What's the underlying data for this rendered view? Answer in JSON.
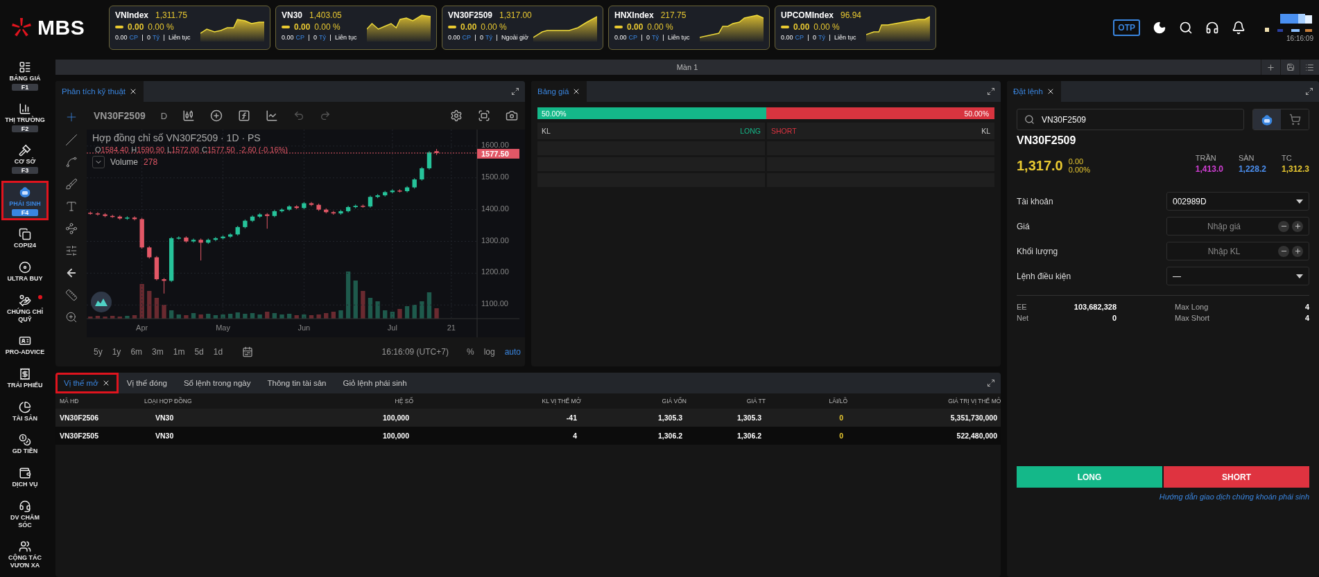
{
  "header": {
    "logo": "MBS",
    "tickers": [
      {
        "name": "VNIndex",
        "value": "1,311.75",
        "change": "0.00",
        "percent": "0.00 %",
        "volume": "0.00",
        "volume_unit": "CP",
        "traded": "0",
        "traded_unit": "Tỷ",
        "session": "Liên tục"
      },
      {
        "name": "VN30",
        "value": "1,403.05",
        "change": "0.00",
        "percent": "0.00 %",
        "volume": "0.00",
        "volume_unit": "CP",
        "traded": "0",
        "traded_unit": "Tỷ",
        "session": "Liên tục"
      },
      {
        "name": "VN30F2509",
        "value": "1,317.00",
        "change": "0.00",
        "percent": "0.00 %",
        "volume": "0.00",
        "volume_unit": "CP",
        "traded": "0",
        "traded_unit": "Tỷ",
        "session": "Ngoài giờ"
      },
      {
        "name": "HNXIndex",
        "value": "217.75",
        "change": "0.00",
        "percent": "0.00 %",
        "volume": "0.00",
        "volume_unit": "CP",
        "traded": "0",
        "traded_unit": "Tỷ",
        "session": "Liên tục"
      },
      {
        "name": "UPCOMIndex",
        "value": "96.94",
        "change": "0.00",
        "percent": "0.00 %",
        "volume": "0.00",
        "volume_unit": "CP",
        "traded": "0",
        "traded_unit": "Tỷ",
        "session": "Liên tục"
      }
    ],
    "otp": "OTP",
    "time": "16:16:09"
  },
  "sidebar": {
    "items": [
      {
        "label": "BẢNG GIÁ",
        "key": "F1",
        "selected": false
      },
      {
        "label": "THỊ TRƯỜNG",
        "key": "F2",
        "selected": false
      },
      {
        "label": "CƠ SỞ",
        "key": "F3",
        "selected": false
      },
      {
        "label": "PHÁI SINH",
        "key": "F4",
        "selected": true
      },
      {
        "label": "COPI24",
        "selected": false
      },
      {
        "label": "ULTRA BUY",
        "selected": false
      },
      {
        "label": "CHỨNG CHỈ QUỸ",
        "selected": false,
        "dot": true
      },
      {
        "label": "PRO-ADVICE",
        "selected": false
      },
      {
        "label": "TRÁI PHIẾU",
        "selected": false
      },
      {
        "label": "TÀI SẢN",
        "selected": false
      },
      {
        "label": "GD TIỀN",
        "selected": false
      },
      {
        "label": "DỊCH VỤ",
        "selected": false
      },
      {
        "label": "DV CHĂM SÓC",
        "selected": false
      },
      {
        "label": "CỘNG TÁC VƯƠN XA",
        "selected": false
      }
    ]
  },
  "workspace": {
    "title": "Màn 1"
  },
  "chart_panel": {
    "tab": "Phân tích kỹ thuật",
    "symbol": "VN30F2509",
    "interval": "D",
    "legend": "Hợp đồng chỉ số VN30F2509 · 1D · PS",
    "ohlc": [
      {
        "label": "O",
        "value": "1584.40"
      },
      {
        "label": "H",
        "value": "1590.90"
      },
      {
        "label": "L",
        "value": "1572.00"
      },
      {
        "label": "C",
        "value": "1577.50"
      }
    ],
    "change": "-2.60 (-0.16%)",
    "volume_label": "Volume",
    "volume_value": "278",
    "last_price": "1577.50",
    "ranges": [
      "5y",
      "1y",
      "6m",
      "3m",
      "1m",
      "5d",
      "1d"
    ],
    "time": "16:16:09 (UTC+7)",
    "scale_options": [
      {
        "label": "%",
        "selected": false
      },
      {
        "label": "log",
        "selected": false
      },
      {
        "label": "auto",
        "selected": true
      }
    ],
    "chart_data": {
      "type": "candlestick",
      "categories": [
        null,
        null,
        null,
        null,
        null,
        null,
        null,
        "Apr",
        null,
        null,
        null,
        null,
        null,
        null,
        null,
        null,
        null,
        null,
        "May",
        null,
        null,
        null,
        null,
        null,
        null,
        null,
        null,
        null,
        null,
        "Jun",
        null,
        null,
        null,
        null,
        null,
        null,
        null,
        null,
        null,
        null,
        null,
        "Jul",
        null,
        null,
        null,
        null,
        null,
        null,
        null,
        "21",
        null,
        null,
        null
      ],
      "ohlc": [
        [
          1390,
          1394,
          1384,
          1388
        ],
        [
          1388,
          1392,
          1381,
          1385
        ],
        [
          1385,
          1389,
          1376,
          1380
        ],
        [
          1380,
          1384,
          1374,
          1378
        ],
        [
          1378,
          1382,
          1368,
          1372
        ],
        [
          1372,
          1379,
          1368,
          1375
        ],
        [
          1375,
          1379,
          1366,
          1370
        ],
        [
          1370,
          1374,
          1277,
          1281
        ],
        [
          1281,
          1285,
          1246,
          1250
        ],
        [
          1250,
          1254,
          1177,
          1181
        ],
        [
          1181,
          1185,
          1136,
          1176
        ],
        [
          1176,
          1314,
          1172,
          1310
        ],
        [
          1310,
          1316,
          1306,
          1312
        ],
        [
          1312,
          1316,
          1296,
          1300
        ],
        [
          1300,
          1309,
          1296,
          1305
        ],
        [
          1305,
          1309,
          1240,
          1296
        ],
        [
          1296,
          1309,
          1292,
          1305
        ],
        [
          1305,
          1314,
          1301,
          1310
        ],
        [
          1310,
          1319,
          1306,
          1315
        ],
        [
          1315,
          1326,
          1311,
          1322
        ],
        [
          1322,
          1349,
          1318,
          1345
        ],
        [
          1345,
          1369,
          1341,
          1365
        ],
        [
          1365,
          1382,
          1361,
          1378
        ],
        [
          1378,
          1389,
          1374,
          1385
        ],
        [
          1385,
          1389,
          1340,
          1380
        ],
        [
          1380,
          1399,
          1376,
          1395
        ],
        [
          1395,
          1404,
          1391,
          1400
        ],
        [
          1400,
          1414,
          1396,
          1410
        ],
        [
          1410,
          1414,
          1401,
          1405
        ],
        [
          1405,
          1424,
          1401,
          1420
        ],
        [
          1420,
          1424,
          1411,
          1415
        ],
        [
          1415,
          1419,
          1396,
          1400
        ],
        [
          1400,
          1404,
          1388,
          1392
        ],
        [
          1392,
          1396,
          1384,
          1388
        ],
        [
          1388,
          1399,
          1384,
          1395
        ],
        [
          1395,
          1412,
          1391,
          1408
        ],
        [
          1408,
          1416,
          1404,
          1412
        ],
        [
          1412,
          1416,
          1406,
          1410
        ],
        [
          1410,
          1444,
          1406,
          1440
        ],
        [
          1440,
          1449,
          1436,
          1445
        ],
        [
          1445,
          1459,
          1441,
          1455
        ],
        [
          1455,
          1464,
          1451,
          1460
        ],
        [
          1460,
          1464,
          1454,
          1458
        ],
        [
          1458,
          1474,
          1454,
          1470
        ],
        [
          1470,
          1499,
          1466,
          1495
        ],
        [
          1495,
          1534,
          1491,
          1530
        ],
        [
          1530,
          1584,
          1526,
          1580
        ],
        [
          1584,
          1591,
          1572,
          1578
        ],
        null,
        null,
        null,
        null,
        null
      ],
      "ylim": [
        1057,
        1652
      ],
      "grid": true,
      "yticks": [
        {
          "value": 1100,
          "label": "1100.00"
        },
        {
          "value": 1200,
          "label": "1200.00"
        },
        {
          "value": 1300,
          "label": "1300.00"
        },
        {
          "value": 1400,
          "label": "1400.00"
        },
        {
          "value": 1500,
          "label": "1500.00"
        },
        {
          "value": 1600,
          "label": "1600.00"
        }
      ]
    }
  },
  "price_board": {
    "tab": "Bảng giá",
    "long": {
      "share": "50.00%",
      "level": 0.5
    },
    "short": {
      "share": "50.00%"
    },
    "columns": [
      "KL",
      "LONG",
      "SHORT",
      "KL"
    ]
  },
  "order_panel": {
    "tab": "Đặt lệnh",
    "search_value": "VN30F2509",
    "symbol": "VN30F2509",
    "price": "1,317.0",
    "change": "0.00",
    "percent": "0.00%",
    "ref_prices": [
      {
        "label": "TRẦN",
        "value": "1,413.0",
        "color": "#d23fd6"
      },
      {
        "label": "SÀN",
        "value": "1,228.2",
        "color": "#4b8ff0"
      },
      {
        "label": "TC",
        "value": "1,312.3",
        "color": "#e9c931"
      }
    ],
    "modes": [
      {
        "kind": "derivative",
        "selected": true
      },
      {
        "kind": "cart",
        "selected": false
      }
    ],
    "fields": [
      {
        "kind": "select",
        "label": "Tài khoản",
        "value": "002989D"
      },
      {
        "kind": "stepper",
        "label": "Giá",
        "placeholder": "Nhập giá"
      },
      {
        "kind": "stepper",
        "label": "Khối lượng",
        "placeholder": "Nhập KL"
      },
      {
        "kind": "select",
        "label": "Lệnh điều kiện",
        "value": "—"
      }
    ],
    "stats": [
      {
        "label": "EE",
        "value": "103,682,328"
      },
      {
        "label": "Max Long",
        "value": "4"
      },
      {
        "label": "Net",
        "value": "0"
      },
      {
        "label": "Max Short",
        "value": "4"
      }
    ],
    "buttons": [
      {
        "kind": "long",
        "label": "LONG"
      },
      {
        "kind": "short",
        "label": "SHORT"
      }
    ],
    "guide_link": "Hướng dẫn giao dịch chứng khoán phái sinh"
  },
  "positions": {
    "tabs": [
      {
        "label": "Vị thế mở",
        "selected": true
      },
      {
        "label": "Vị thế đóng",
        "selected": false
      },
      {
        "label": "Sổ lệnh trong ngày",
        "selected": false
      },
      {
        "label": "Thông tin tài sản",
        "selected": false
      },
      {
        "label": "Giỏ lệnh phái sinh",
        "selected": false
      }
    ],
    "columns": [
      "MÃ HĐ",
      "LOẠI HỢP ĐỒNG",
      "HỆ SỐ",
      "KL VỊ THẾ MỞ",
      "GIÁ VỐN",
      "GIÁ TT",
      "LÃI/LỖ",
      "GIÁ TRỊ VỊ THẾ MỞ"
    ],
    "rows": [
      [
        "VN30F2506",
        "VN30",
        "100,000",
        "-41",
        "1,305.3",
        "1,305.3",
        "0",
        "5,351,730,000"
      ],
      [
        "VN30F2505",
        "VN30",
        "100,000",
        "4",
        "1,306.2",
        "1,306.2",
        "0",
        "522,480,000"
      ]
    ]
  }
}
